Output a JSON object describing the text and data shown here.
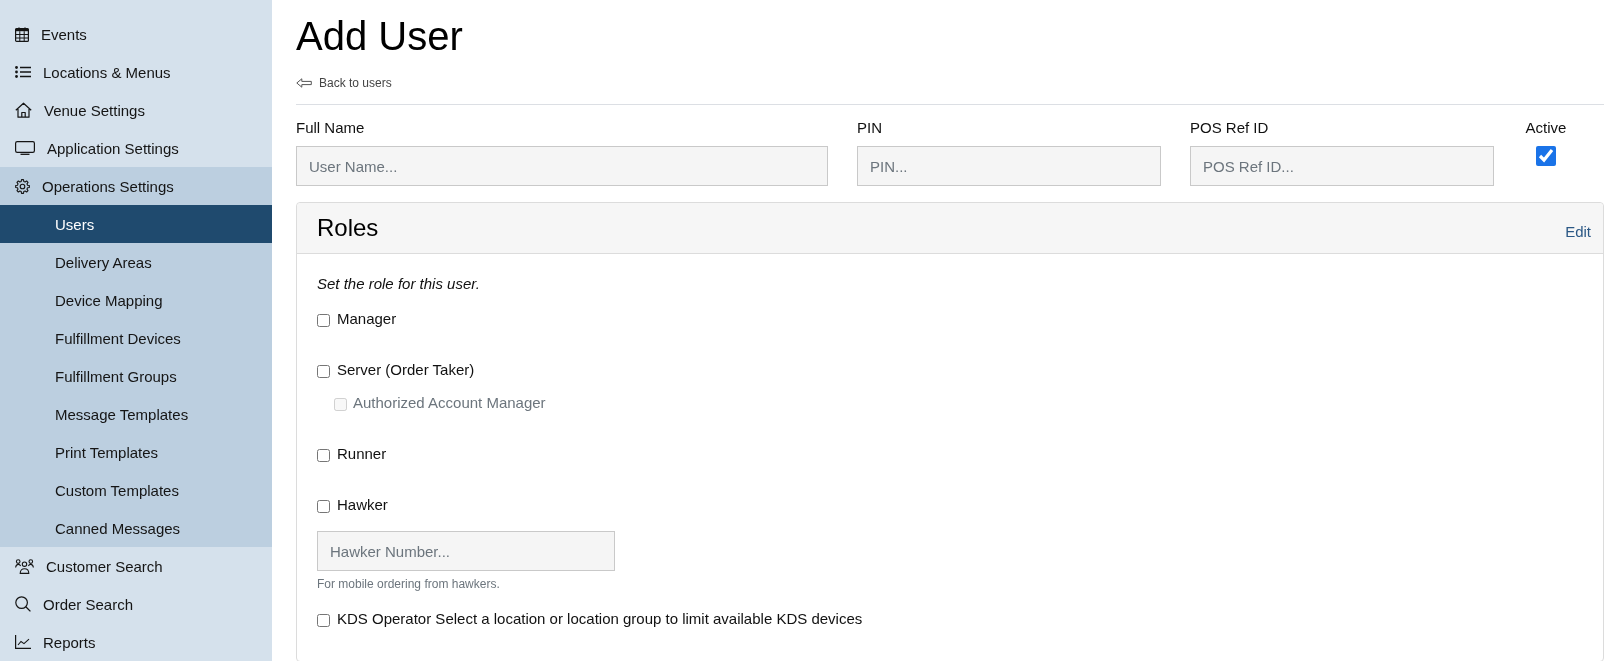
{
  "sidebar": {
    "items": [
      {
        "label": "Events",
        "selected": false,
        "expanded": false
      },
      {
        "label": "Locations & Menus",
        "selected": false,
        "expanded": false
      },
      {
        "label": "Venue Settings",
        "selected": false,
        "expanded": false
      },
      {
        "label": "Application Settings",
        "selected": false,
        "expanded": false
      },
      {
        "label": "Operations Settings",
        "selected": false,
        "expanded": true,
        "children": [
          {
            "label": "Users",
            "selected": true
          },
          {
            "label": "Delivery Areas",
            "selected": false
          },
          {
            "label": "Device Mapping",
            "selected": false
          },
          {
            "label": "Fulfillment Devices",
            "selected": false
          },
          {
            "label": "Fulfillment Groups",
            "selected": false
          },
          {
            "label": "Message Templates",
            "selected": false
          },
          {
            "label": "Print Templates",
            "selected": false
          },
          {
            "label": "Custom Templates",
            "selected": false
          },
          {
            "label": "Canned Messages",
            "selected": false
          }
        ]
      },
      {
        "label": "Customer Search",
        "selected": false,
        "expanded": false
      },
      {
        "label": "Order Search",
        "selected": false,
        "expanded": false
      },
      {
        "label": "Reports",
        "selected": false,
        "expanded": false
      }
    ]
  },
  "page": {
    "title": "Add User",
    "back_link": "Back to users"
  },
  "form": {
    "fields": [
      {
        "label": "Full Name",
        "placeholder": "User Name..."
      },
      {
        "label": "PIN",
        "placeholder": "PIN..."
      },
      {
        "label": "POS Ref ID",
        "placeholder": "POS Ref ID..."
      }
    ],
    "active": {
      "label": "Active",
      "checked": true
    }
  },
  "roles": {
    "title": "Roles",
    "edit": "Edit",
    "instruction": "Set the role for this user.",
    "options": [
      {
        "label": "Manager",
        "checked": false,
        "disabled": false
      },
      {
        "label": "Server (Order Taker)",
        "checked": false,
        "disabled": false,
        "children": [
          {
            "label": "Authorized Account Manager",
            "checked": false,
            "disabled": true
          }
        ]
      },
      {
        "label": "Runner",
        "checked": false,
        "disabled": false
      },
      {
        "label": "Hawker",
        "checked": false,
        "disabled": false,
        "field": {
          "placeholder": "Hawker Number...",
          "hint": "For mobile ordering from hawkers."
        }
      },
      {
        "label": "KDS Operator Select a location or location group to limit available KDS devices",
        "checked": false,
        "disabled": false
      }
    ]
  }
}
